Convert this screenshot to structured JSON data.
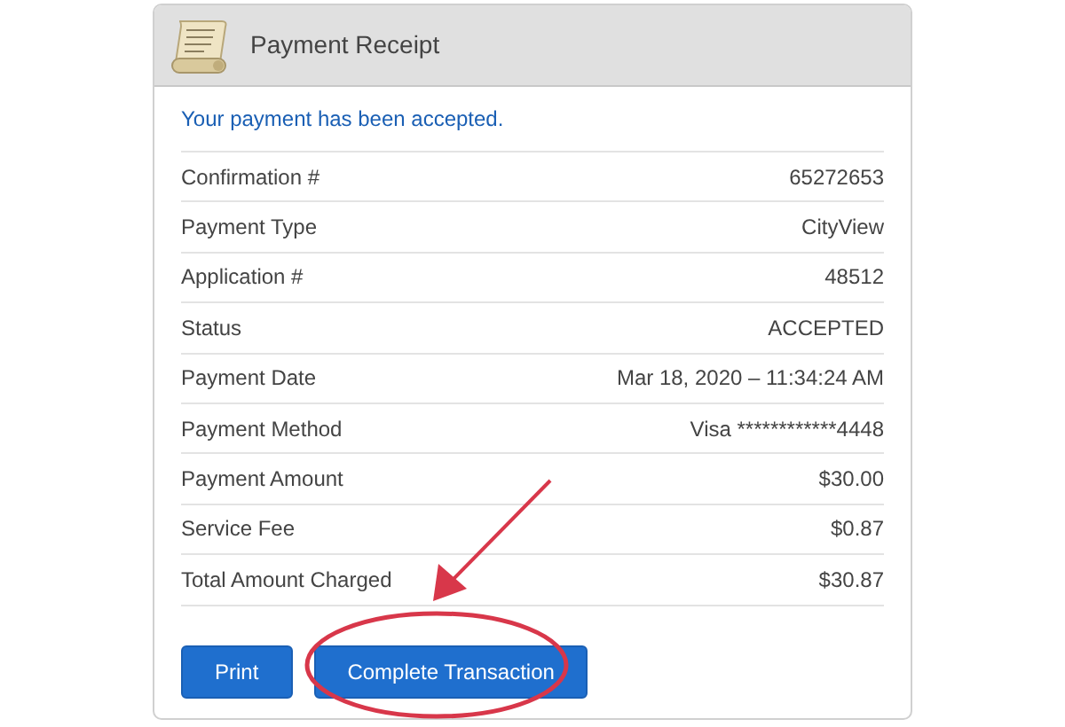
{
  "card": {
    "title": "Payment Receipt",
    "message": "Your payment has been accepted."
  },
  "rows": [
    {
      "label": "Confirmation #",
      "value": "65272653"
    },
    {
      "label": "Payment Type",
      "value": "CityView"
    },
    {
      "label": "Application #",
      "value": "48512"
    },
    {
      "label": "Status",
      "value": "ACCEPTED"
    },
    {
      "label": "Payment Date",
      "value": "Mar 18, 2020 – 11:34:24 AM"
    },
    {
      "label": "Payment Method",
      "value": "Visa ************4448"
    },
    {
      "label": "Payment Amount",
      "value": "$30.00"
    },
    {
      "label": "Service Fee",
      "value": "$0.87"
    },
    {
      "label": "Total Amount Charged",
      "value": "$30.87"
    }
  ],
  "buttons": [
    "Print",
    "Complete Transaction"
  ]
}
